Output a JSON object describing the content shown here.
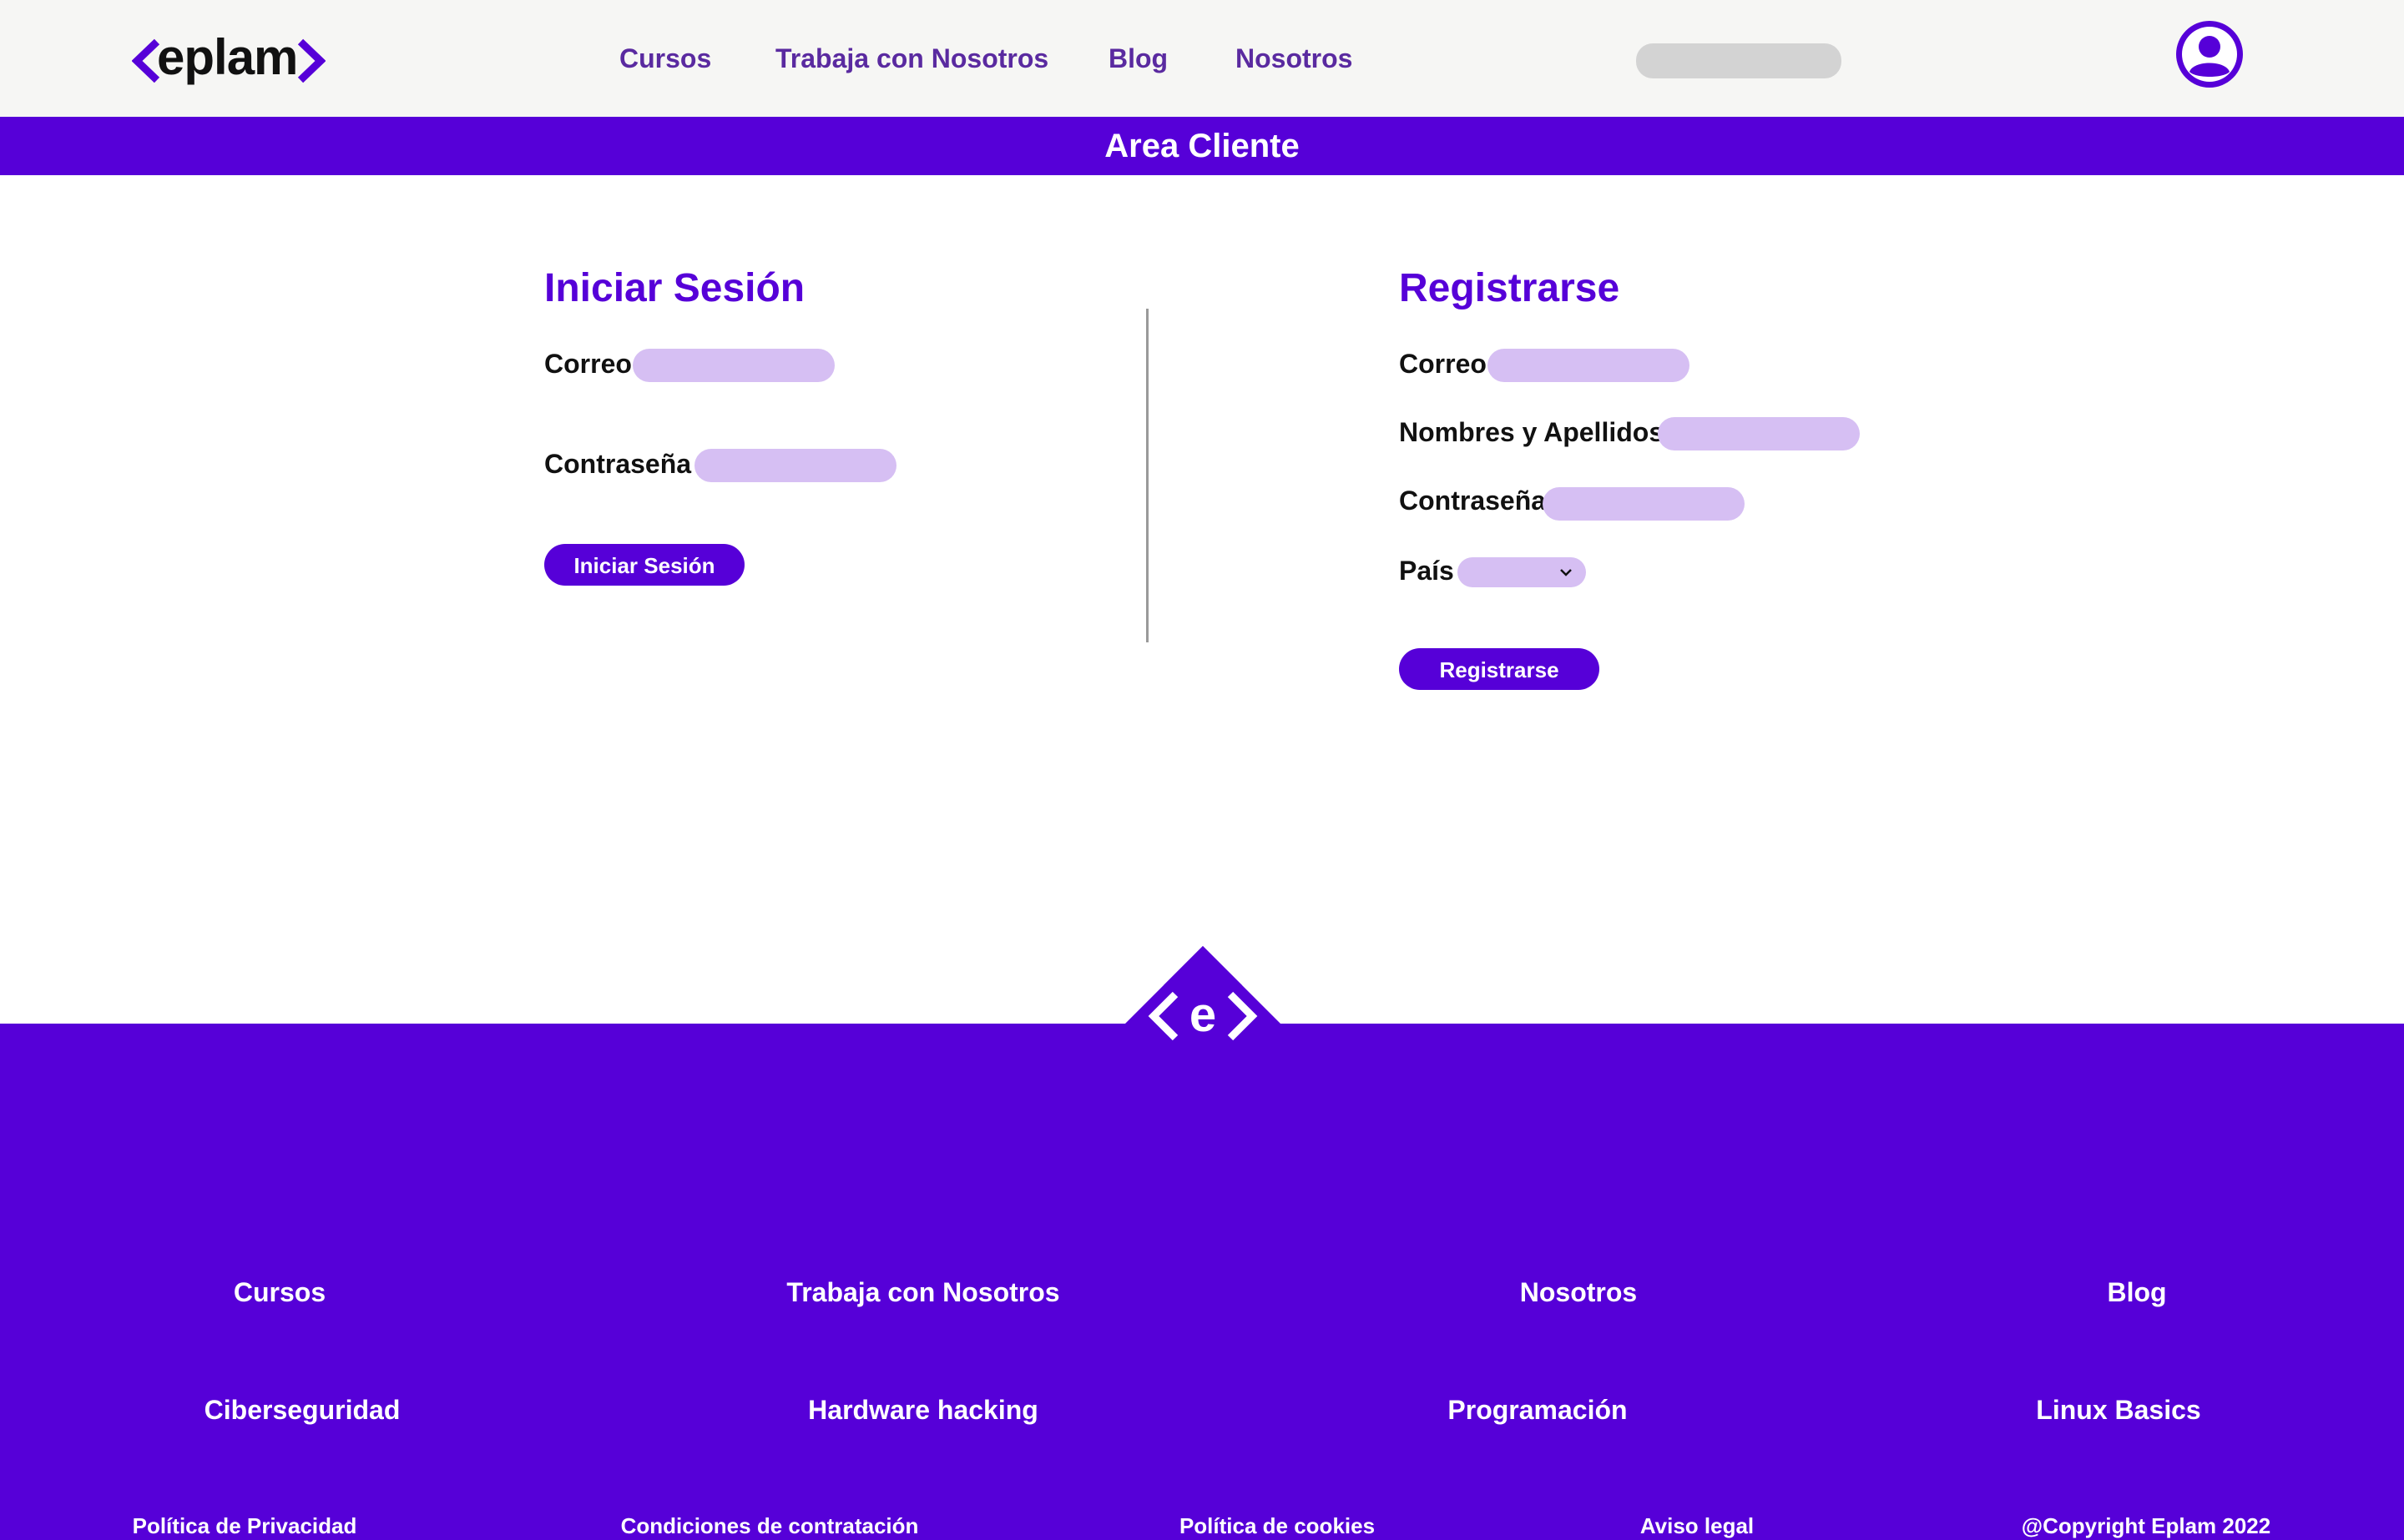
{
  "header": {
    "logo": "eplam",
    "nav": [
      "Cursos",
      "Trabaja con Nosotros",
      "Blog",
      "Nosotros"
    ],
    "search_placeholder": "",
    "avatar_icon": "user-avatar-icon"
  },
  "banner": {
    "title": "Area Cliente"
  },
  "login": {
    "title": "Iniciar Sesión",
    "email_label": "Correo",
    "password_label": "Contraseña",
    "submit_label": "Iniciar Sesión"
  },
  "register": {
    "title": "Registrarse",
    "email_label": "Correo",
    "name_label": "Nombres y Apellidos",
    "password_label": "Contraseña",
    "country_label": "País",
    "country_selected": "",
    "submit_label": "Registrarse"
  },
  "footer": {
    "emblem_icon": "eplam-emblem-icon",
    "main_links": [
      "Cursos",
      "Trabaja con Nosotros",
      "Nosotros",
      "Blog"
    ],
    "course_links": [
      "Ciberseguridad",
      "Hardware hacking",
      "Programación",
      "Linux Basics"
    ],
    "legal_links": [
      "Política de Privacidad",
      "Condiciones de contratación",
      "Política de cookies",
      "Aviso legal"
    ],
    "copyright": "@Copyright Eplam 2022"
  },
  "colors": {
    "brand_purple": "#5600d8",
    "input_fill": "#d6bff3",
    "nav_text": "#5a2aa0",
    "header_bg": "#f6f6f4"
  }
}
